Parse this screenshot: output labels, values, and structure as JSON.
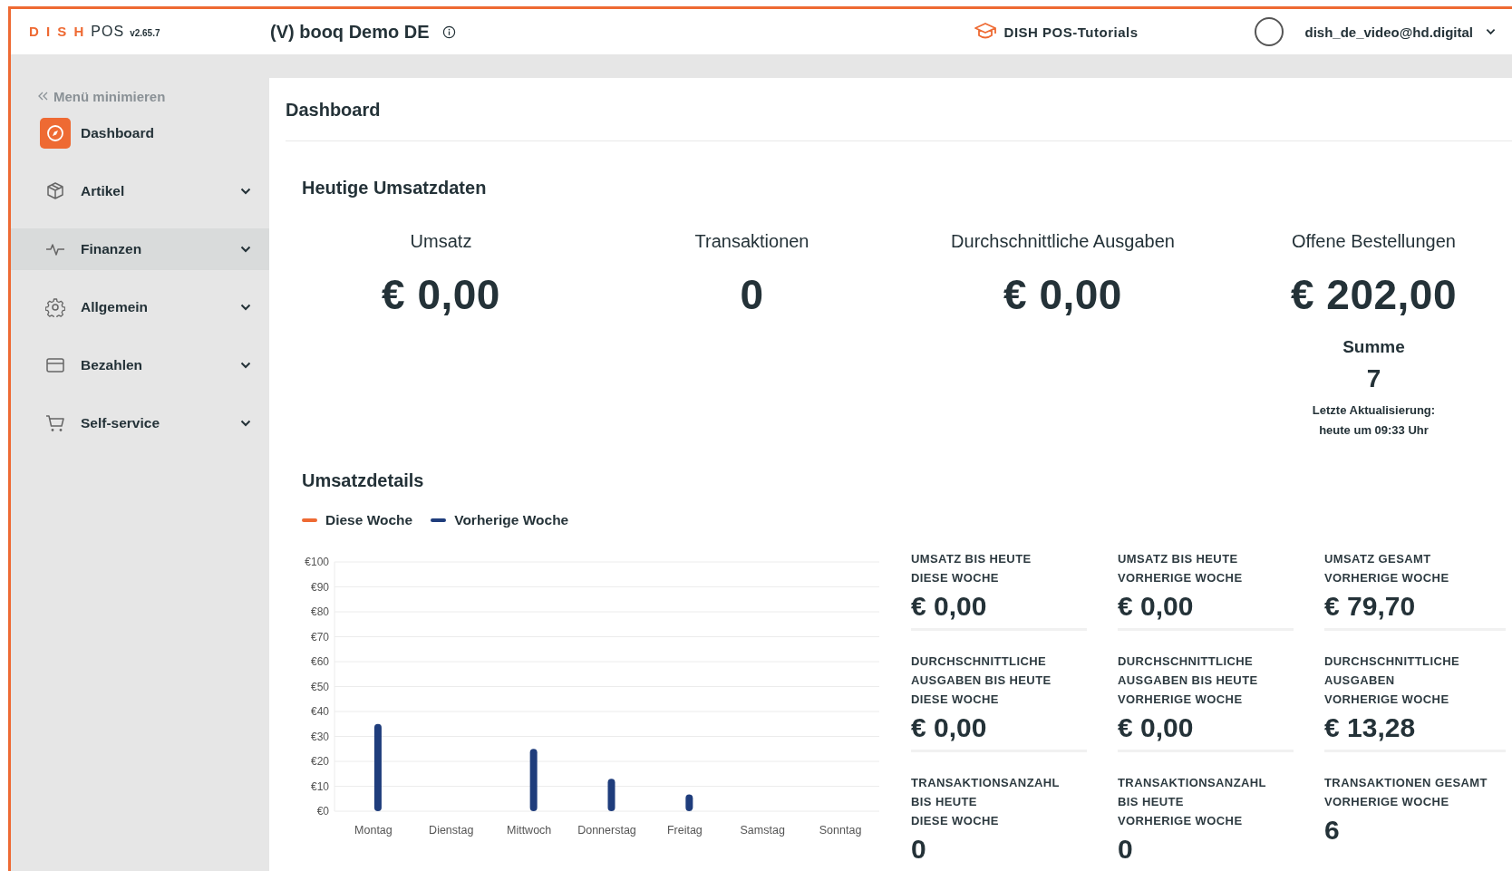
{
  "header": {
    "logo": {
      "brand": "D I S H",
      "product": "POS",
      "version": "v2.65.7"
    },
    "venue": "(V) booq Demo DE",
    "tutorials": "DISH POS-Tutorials",
    "user": "dish_de_video@hd.digital"
  },
  "sidebar": {
    "collapse": "Menü minimieren",
    "items": [
      {
        "label": "Dashboard",
        "selected": true,
        "hovered": false,
        "expandable": false
      },
      {
        "label": "Artikel",
        "selected": false,
        "hovered": false,
        "expandable": true
      },
      {
        "label": "Finanzen",
        "selected": false,
        "hovered": true,
        "expandable": true
      },
      {
        "label": "Allgemein",
        "selected": false,
        "hovered": false,
        "expandable": true
      },
      {
        "label": "Bezahlen",
        "selected": false,
        "hovered": false,
        "expandable": true
      },
      {
        "label": "Self-service",
        "selected": false,
        "hovered": false,
        "expandable": true
      }
    ]
  },
  "page_title": "Dashboard",
  "today": {
    "title": "Heutige Umsatzdaten",
    "kpis": [
      {
        "label": "Umsatz",
        "value": "€ 0,00"
      },
      {
        "label": "Transaktionen",
        "value": "0"
      },
      {
        "label": "Durchschnittliche Ausgaben",
        "value": "€ 0,00"
      },
      {
        "label": "Offene Bestellungen",
        "value": "€ 202,00",
        "sum_label": "Summe",
        "sum_value": "7",
        "updated_lines": [
          "Letzte Aktualisierung:",
          "heute um 09:33 Uhr"
        ]
      }
    ]
  },
  "details": {
    "title": "Umsatzdetails",
    "chart_data": {
      "type": "bar",
      "grid": true,
      "categories": [
        "Montag",
        "Dienstag",
        "Mittwoch",
        "Donnerstag",
        "Freitag",
        "Samstag",
        "Sonntag"
      ],
      "series": [
        {
          "name": "Diese Woche",
          "color": "#ee6a33",
          "values": [
            null,
            null,
            null,
            null,
            null,
            null,
            null
          ]
        },
        {
          "name": "Vorherige Woche",
          "color": "#1f3d7c",
          "values": [
            35,
            null,
            25,
            13,
            6.7,
            null,
            null
          ]
        }
      ],
      "ylim": [
        0,
        100
      ],
      "yticks": [
        {
          "value": 0,
          "label": "€0"
        },
        {
          "value": 10,
          "label": "€10"
        },
        {
          "value": 20,
          "label": "€20"
        },
        {
          "value": 30,
          "label": "€30"
        },
        {
          "value": 40,
          "label": "€40"
        },
        {
          "value": 50,
          "label": "€50"
        },
        {
          "value": 60,
          "label": "€60"
        },
        {
          "value": 70,
          "label": "€70"
        },
        {
          "value": 80,
          "label": "€80"
        },
        {
          "value": 90,
          "label": "€90"
        },
        {
          "value": 100,
          "label": "€100"
        }
      ]
    },
    "stats": [
      {
        "label_lines": [
          "UMSATZ BIS HEUTE",
          "DIESE WOCHE"
        ],
        "value": "€ 0,00"
      },
      {
        "label_lines": [
          "UMSATZ BIS HEUTE",
          "VORHERIGE WOCHE"
        ],
        "value": "€ 0,00"
      },
      {
        "label_lines": [
          "UMSATZ GESAMT",
          "VORHERIGE WOCHE"
        ],
        "value": "€ 79,70"
      },
      {
        "label_lines": [
          "DURCHSCHNITTLICHE",
          "AUSGABEN BIS HEUTE",
          "DIESE WOCHE"
        ],
        "value": "€ 0,00"
      },
      {
        "label_lines": [
          "DURCHSCHNITTLICHE",
          "AUSGABEN BIS HEUTE",
          "VORHERIGE WOCHE"
        ],
        "value": "€ 0,00"
      },
      {
        "label_lines": [
          "DURCHSCHNITTLICHE",
          "AUSGABEN",
          "VORHERIGE WOCHE"
        ],
        "value": "€ 13,28"
      },
      {
        "label_lines": [
          "TRANSAKTIONSANZAHL",
          "BIS HEUTE",
          "DIESE WOCHE"
        ],
        "value": "0"
      },
      {
        "label_lines": [
          "TRANSAKTIONSANZAHL",
          "BIS HEUTE",
          "VORHERIGE WOCHE"
        ],
        "value": "0"
      },
      {
        "label_lines": [
          "TRANSAKTIONEN GESAMT",
          "VORHERIGE WOCHE"
        ],
        "value": "6"
      }
    ]
  }
}
